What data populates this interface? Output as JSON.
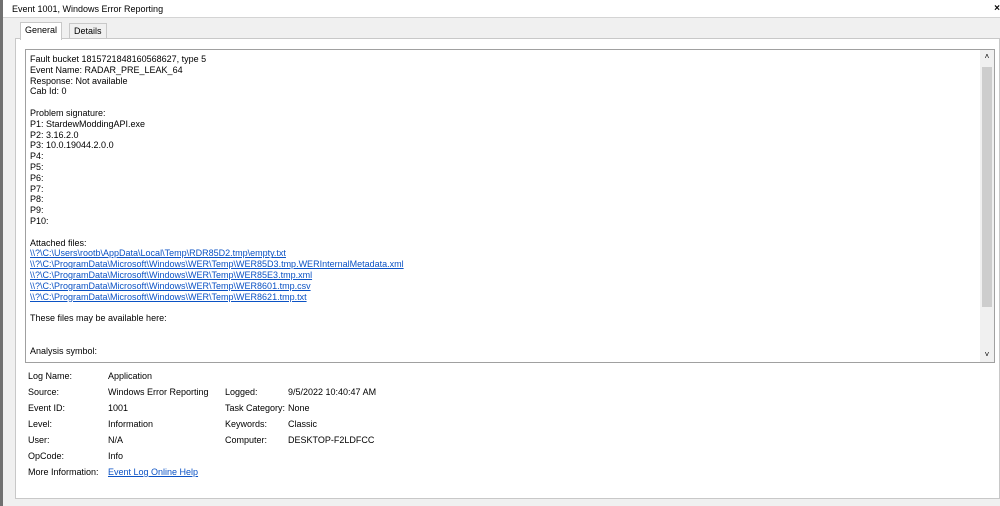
{
  "window": {
    "title": "Event 1001, Windows Error Reporting",
    "close_glyph": "×"
  },
  "tabs": [
    {
      "label": "General",
      "active": true
    },
    {
      "label": "Details",
      "active": false
    }
  ],
  "event_text": {
    "lines": [
      {
        "text": "Fault bucket 1815721848160568627, type 5"
      },
      {
        "text": "Event Name: RADAR_PRE_LEAK_64"
      },
      {
        "text": "Response: Not available"
      },
      {
        "text": "Cab Id: 0"
      },
      {
        "text": ""
      },
      {
        "text": "Problem signature:"
      },
      {
        "text": "P1: StardewModdingAPI.exe"
      },
      {
        "text": "P2: 3.16.2.0"
      },
      {
        "text": "P3: 10.0.19044.2.0.0"
      },
      {
        "text": "P4:"
      },
      {
        "text": "P5:"
      },
      {
        "text": "P6:"
      },
      {
        "text": "P7:"
      },
      {
        "text": "P8:"
      },
      {
        "text": "P9:"
      },
      {
        "text": "P10:"
      },
      {
        "text": ""
      },
      {
        "text": "Attached files:"
      },
      {
        "text": "\\\\?\\C:\\Users\\rootb\\AppData\\Local\\Temp\\RDR85D2.tmp\\empty.txt",
        "link": true
      },
      {
        "text": "\\\\?\\C:\\ProgramData\\Microsoft\\Windows\\WER\\Temp\\WER85D3.tmp.WERInternalMetadata.xml",
        "link": true
      },
      {
        "text": "\\\\?\\C:\\ProgramData\\Microsoft\\Windows\\WER\\Temp\\WER85E3.tmp.xml",
        "link": true
      },
      {
        "text": "\\\\?\\C:\\ProgramData\\Microsoft\\Windows\\WER\\Temp\\WER8601.tmp.csv",
        "link": true
      },
      {
        "text": "\\\\?\\C:\\ProgramData\\Microsoft\\Windows\\WER\\Temp\\WER8621.tmp.txt",
        "link": true
      },
      {
        "text": ""
      },
      {
        "text": "These files may be available here:"
      },
      {
        "text": ""
      },
      {
        "text": ""
      },
      {
        "text": "Analysis symbol:"
      }
    ]
  },
  "scrollbar": {
    "up_glyph": "˄",
    "down_glyph": "˅"
  },
  "properties": {
    "log_name_label": "Log Name:",
    "log_name_value": "Application",
    "source_label": "Source:",
    "source_value": "Windows Error Reporting",
    "logged_label": "Logged:",
    "logged_value": "9/5/2022 10:40:47 AM",
    "event_id_label": "Event ID:",
    "event_id_value": "1001",
    "task_category_label": "Task Category:",
    "task_category_value": "None",
    "level_label": "Level:",
    "level_value": "Information",
    "keywords_label": "Keywords:",
    "keywords_value": "Classic",
    "user_label": "User:",
    "user_value": "N/A",
    "computer_label": "Computer:",
    "computer_value": "DESKTOP-F2LDFCC",
    "opcode_label": "OpCode:",
    "opcode_value": "Info",
    "more_info_label": "More Information:",
    "more_info_link": "Event Log Online Help"
  },
  "colors": {
    "link": "#0b52c4",
    "panel_bg": "#ffffff",
    "window_bg": "#f0f0f0"
  }
}
